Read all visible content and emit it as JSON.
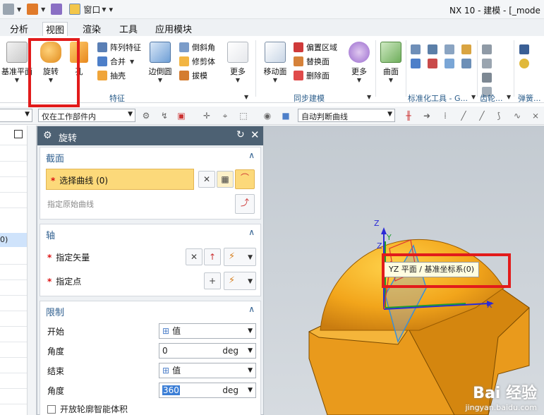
{
  "window": {
    "title": "NX 10 - 建模 - [_mode"
  },
  "quick_access": {
    "window_menu": "窗口"
  },
  "menu_tabs": [
    "分析",
    "视图",
    "渲染",
    "工具",
    "应用模块"
  ],
  "ribbon": {
    "feature_group": {
      "datum_plane": "基准平面",
      "revolve": "旋转",
      "hole": "孔",
      "pattern_feature": "阵列特征",
      "unite": "合并",
      "extract": "抽壳",
      "edge_blend": "边倒圆",
      "chamfer": "倒斜角",
      "trim_body": "修剪体",
      "draft": "拔模",
      "more": "更多",
      "label": "特征"
    },
    "sync_group": {
      "move_face": "移动面",
      "offset_region": "偏置区域",
      "replace_face": "替换面",
      "delete_face": "删除面",
      "more": "更多",
      "label": "同步建模"
    },
    "surface_group": {
      "surface": "曲面"
    },
    "standard_parts_label": "标准化工具 - G...",
    "gear_label": "齿轮...",
    "spring_label": "弹簧..."
  },
  "toolbar2": {
    "scope_filter": "仅在工作部件内",
    "curve_rule": "自动判断曲线"
  },
  "dialog": {
    "title": "旋转",
    "section_profile": {
      "title": "截面",
      "select_curve": "选择曲线 (0)",
      "specify_origin_curve": "指定原始曲线"
    },
    "section_axis": {
      "title": "轴",
      "specify_vector": "指定矢量",
      "specify_point": "指定点"
    },
    "section_limits": {
      "title": "限制",
      "start_label": "开始",
      "start_type": "值",
      "start_angle_label": "角度",
      "start_angle_value": "0",
      "end_label": "结束",
      "end_type": "值",
      "end_angle_label": "角度",
      "end_angle_value": "360",
      "unit": "deg",
      "open_profile_checkbox": "开放轮廓智能体积"
    }
  },
  "navigator": {
    "selected_marker": "0)"
  },
  "viewport": {
    "tooltip": "YZ 平面 / 基准坐标系(0)",
    "axis_x": "X",
    "axis_y": "Y",
    "axis_z": "Z",
    "axis_z2": "Z"
  },
  "watermark": {
    "brand": "Bai 经验",
    "url": "jingyan.baidu.com"
  }
}
